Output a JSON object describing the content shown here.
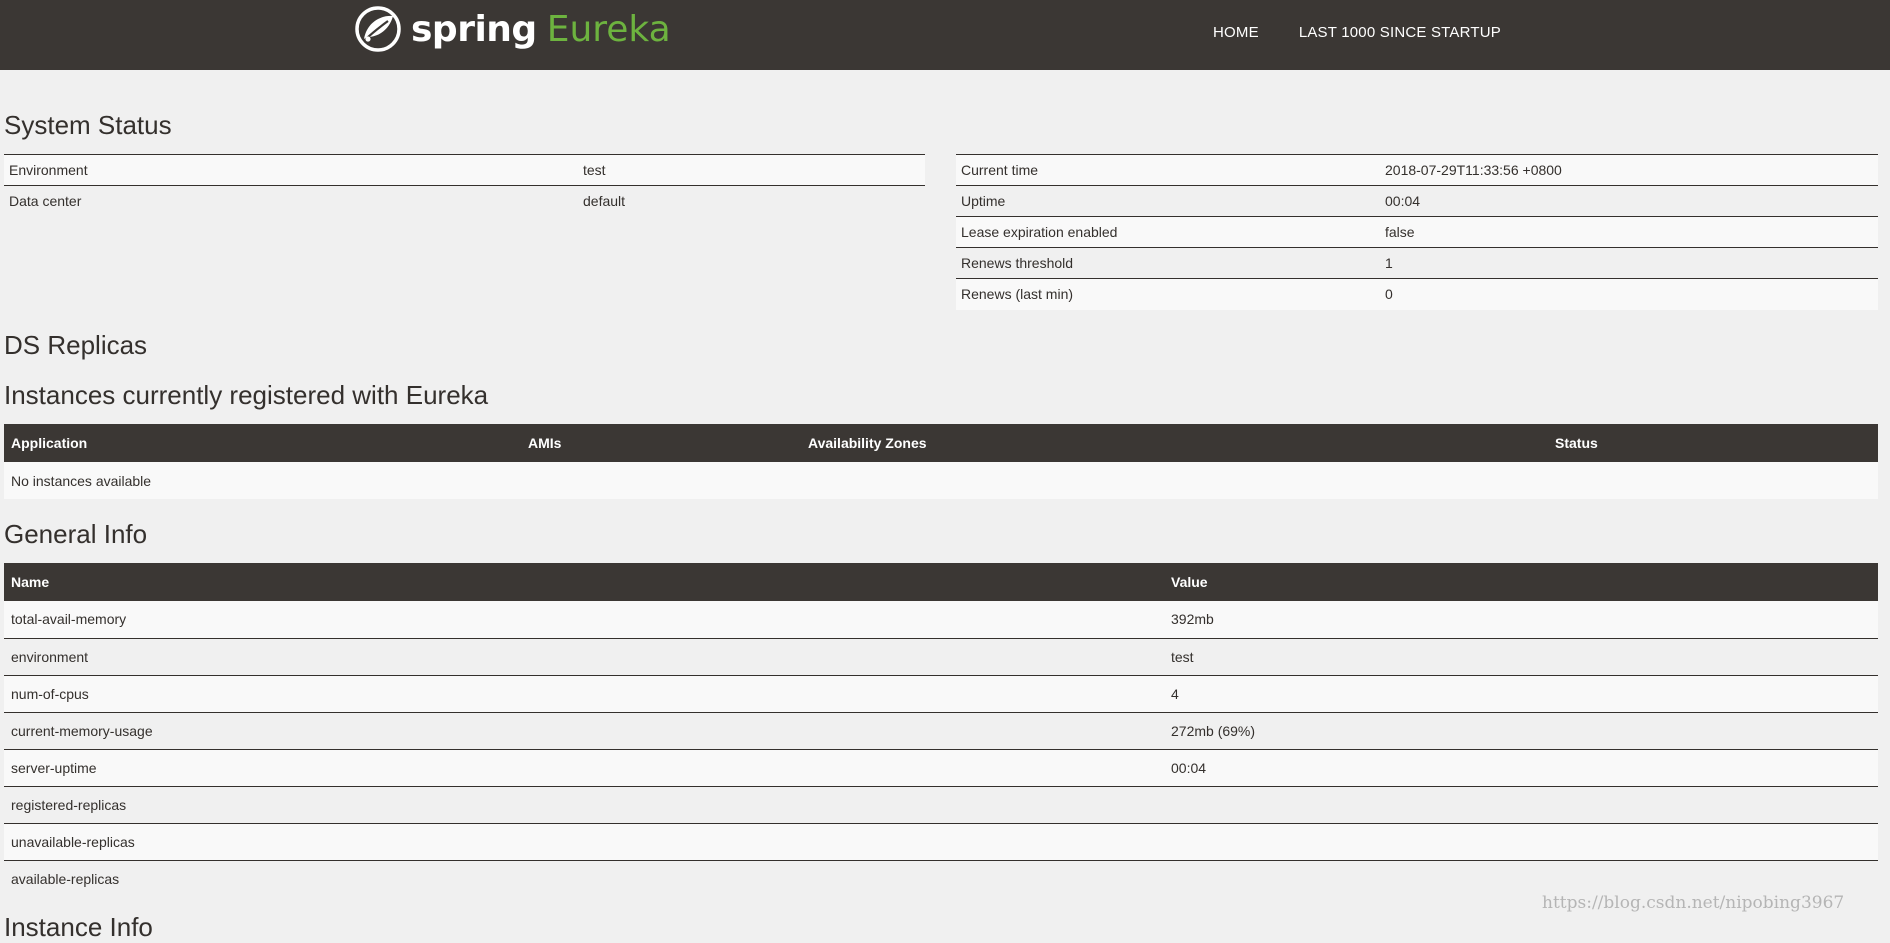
{
  "brand": {
    "spring": "spring",
    "eureka": "Eureka"
  },
  "nav": {
    "home": "HOME",
    "last1000": "LAST 1000 SINCE STARTUP"
  },
  "system_status": {
    "title": "System Status",
    "left": [
      {
        "key": "Environment",
        "value": "test"
      },
      {
        "key": "Data center",
        "value": "default"
      }
    ],
    "right": [
      {
        "key": "Current time",
        "value": "2018-07-29T11:33:56 +0800"
      },
      {
        "key": "Uptime",
        "value": "00:04"
      },
      {
        "key": "Lease expiration enabled",
        "value": "false"
      },
      {
        "key": "Renews threshold",
        "value": "1"
      },
      {
        "key": "Renews (last min)",
        "value": "0"
      }
    ]
  },
  "ds_replicas": {
    "title": "DS Replicas"
  },
  "instances": {
    "title": "Instances currently registered with Eureka",
    "columns": [
      "Application",
      "AMIs",
      "Availability Zones",
      "Status"
    ],
    "empty_message": "No instances available"
  },
  "general_info": {
    "title": "General Info",
    "columns": [
      "Name",
      "Value"
    ],
    "rows": [
      {
        "name": "total-avail-memory",
        "value": "392mb"
      },
      {
        "name": "environment",
        "value": "test"
      },
      {
        "name": "num-of-cpus",
        "value": "4"
      },
      {
        "name": "current-memory-usage",
        "value": "272mb (69%)"
      },
      {
        "name": "server-uptime",
        "value": "00:04"
      },
      {
        "name": "registered-replicas",
        "value": ""
      },
      {
        "name": "unavailable-replicas",
        "value": ""
      },
      {
        "name": "available-replicas",
        "value": ""
      }
    ]
  },
  "partial_heading": "Instance Info",
  "watermark": "https://blog.csdn.net/nipobing3967",
  "colors": {
    "navbar": "#3b3734",
    "accent": "#6db33f",
    "background": "#f0f0f0",
    "text": "#34302d"
  },
  "icons": {
    "logo": "spring-leaf-icon"
  }
}
